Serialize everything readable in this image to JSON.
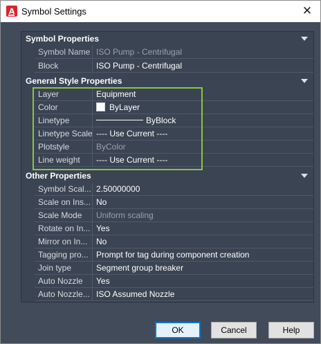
{
  "window": {
    "title": "Symbol Settings",
    "close_glyph": "✕",
    "app_icon_letter": "A"
  },
  "sections": {
    "symbol_properties": {
      "header": "Symbol Properties",
      "rows": [
        {
          "label": "Symbol Name",
          "value": "ISO Pump - Centrifugal"
        },
        {
          "label": "Block",
          "value": "ISO Pump - Centrifugal"
        }
      ]
    },
    "general_style": {
      "header": "General Style Properties",
      "rows": [
        {
          "label": "Layer",
          "value": "Equipment"
        },
        {
          "label": "Color",
          "value": "ByLayer"
        },
        {
          "label": "Linetype",
          "value": "ByBlock"
        },
        {
          "label": "Linetype Scale",
          "value": "---- Use Current ----"
        },
        {
          "label": "Plotstyle",
          "value": "ByColor"
        },
        {
          "label": "Line weight",
          "value": "---- Use Current ----"
        }
      ]
    },
    "other_properties": {
      "header": "Other Properties",
      "rows": [
        {
          "label": "Symbol Scal...",
          "value": "2.50000000"
        },
        {
          "label": "Scale on Ins...",
          "value": "No"
        },
        {
          "label": "Scale Mode",
          "value": "Uniform scaling"
        },
        {
          "label": "Rotate on In...",
          "value": "Yes"
        },
        {
          "label": "Mirror on In...",
          "value": "No"
        },
        {
          "label": "Tagging pro...",
          "value": "Prompt for tag during component creation"
        },
        {
          "label": "Join type",
          "value": "Segment group breaker"
        },
        {
          "label": "Auto Nozzle",
          "value": "Yes"
        },
        {
          "label": "Auto Nozzle...",
          "value": "ISO Assumed Nozzle"
        }
      ]
    }
  },
  "buttons": {
    "ok": "OK",
    "cancel": "Cancel",
    "help": "Help"
  },
  "colors": {
    "highlight": "#8cc63f",
    "panel_bg": "#3b4453",
    "dialog_bg": "#414b5a"
  }
}
